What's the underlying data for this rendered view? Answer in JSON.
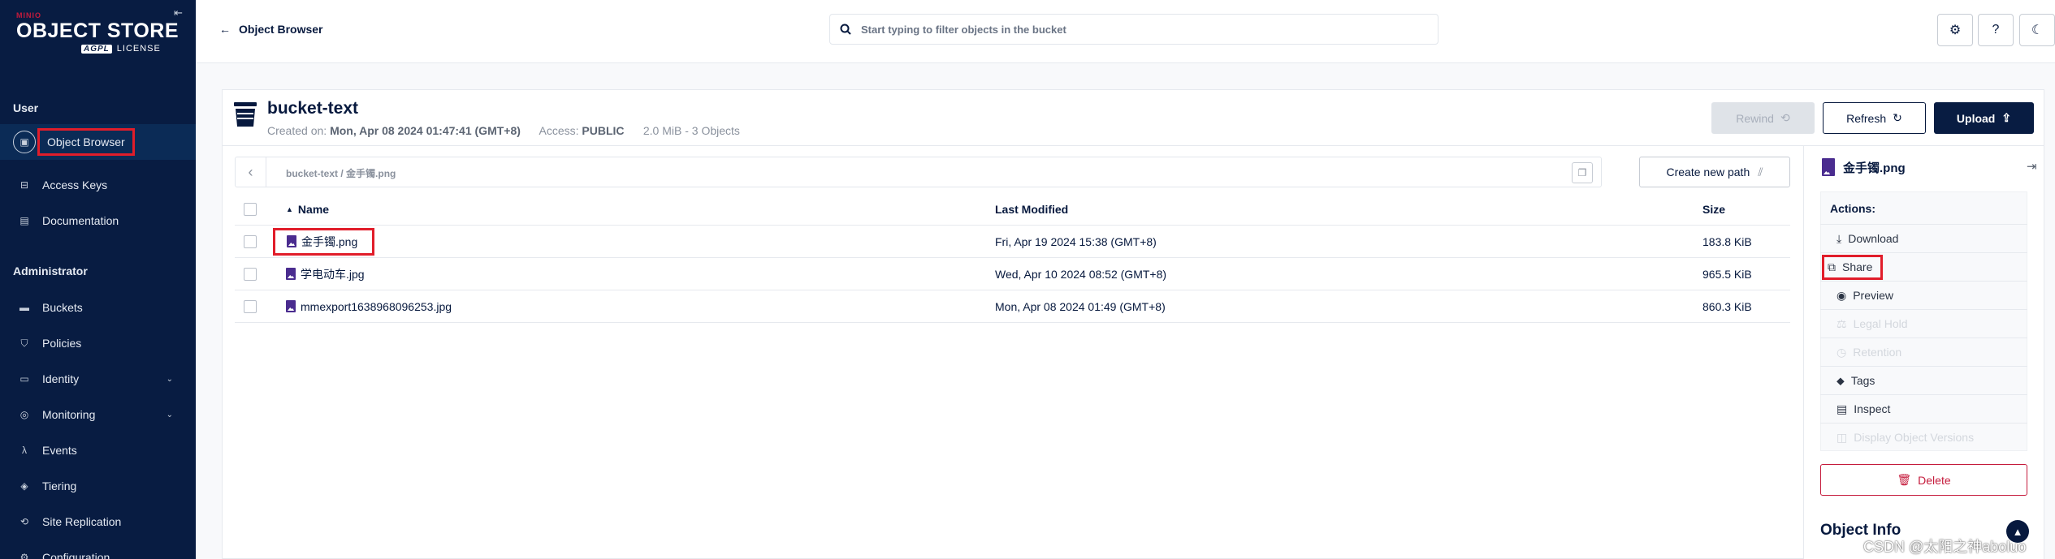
{
  "sidebar": {
    "logo": {
      "brand": "MINIO",
      "product": "OBJECT STORE",
      "agpl": "AGPL",
      "license": "LICENSE"
    },
    "sections": {
      "user": "User",
      "admin": "Administrator"
    },
    "items": [
      {
        "label": "Object Browser",
        "icon": "object-browser-icon"
      },
      {
        "label": "Access Keys",
        "icon": "key-icon"
      },
      {
        "label": "Documentation",
        "icon": "docs-icon"
      },
      {
        "label": "Buckets",
        "icon": "bucket-icon"
      },
      {
        "label": "Policies",
        "icon": "shield-icon"
      },
      {
        "label": "Identity",
        "icon": "identity-icon"
      },
      {
        "label": "Monitoring",
        "icon": "monitoring-icon"
      },
      {
        "label": "Events",
        "icon": "lambda-icon"
      },
      {
        "label": "Tiering",
        "icon": "tiering-icon"
      },
      {
        "label": "Site Replication",
        "icon": "replication-icon"
      },
      {
        "label": "Configuration",
        "icon": "config-icon"
      }
    ]
  },
  "header": {
    "back_label": "Object Browser",
    "search_placeholder": "Start typing to filter objects in the bucket"
  },
  "bucket": {
    "name": "bucket-text",
    "created_label": "Created on:",
    "created_value": "Mon, Apr 08 2024 01:47:41 (GMT+8)",
    "access_label": "Access:",
    "access_value": "PUBLIC",
    "summary": "2.0 MiB - 3 Objects"
  },
  "buttons": {
    "rewind": "Rewind",
    "refresh": "Refresh",
    "upload": "Upload",
    "create_path": "Create new path"
  },
  "path": {
    "bucket": "bucket-text",
    "sep": "/",
    "file": "金手镯.png"
  },
  "table": {
    "headers": {
      "name": "Name",
      "modified": "Last Modified",
      "size": "Size"
    },
    "rows": [
      {
        "name": "金手镯.png",
        "modified": "Fri, Apr 19 2024 15:38 (GMT+8)",
        "size": "183.8 KiB"
      },
      {
        "name": "学电动车.jpg",
        "modified": "Wed, Apr 10 2024 08:52 (GMT+8)",
        "size": "965.5 KiB"
      },
      {
        "name": "mmexport1638968096253.jpg",
        "modified": "Mon, Apr 08 2024 01:49 (GMT+8)",
        "size": "860.3 KiB"
      }
    ]
  },
  "panel": {
    "file_name": "金手镯.png",
    "actions_title": "Actions:",
    "actions": [
      {
        "label": "Download",
        "enabled": true
      },
      {
        "label": "Share",
        "enabled": true
      },
      {
        "label": "Preview",
        "enabled": true
      },
      {
        "label": "Legal Hold",
        "enabled": false
      },
      {
        "label": "Retention",
        "enabled": false
      },
      {
        "label": "Tags",
        "enabled": true
      },
      {
        "label": "Inspect",
        "enabled": true
      },
      {
        "label": "Display Object Versions",
        "enabled": false
      }
    ],
    "delete": "Delete",
    "object_info": "Object Info"
  },
  "watermark": "CSDN @太阳之神aboluo",
  "colors": {
    "sidebar_bg": "#081c42",
    "accent": "#07193e",
    "danger": "#c51b3c",
    "highlight_box": "#e11d2a"
  }
}
